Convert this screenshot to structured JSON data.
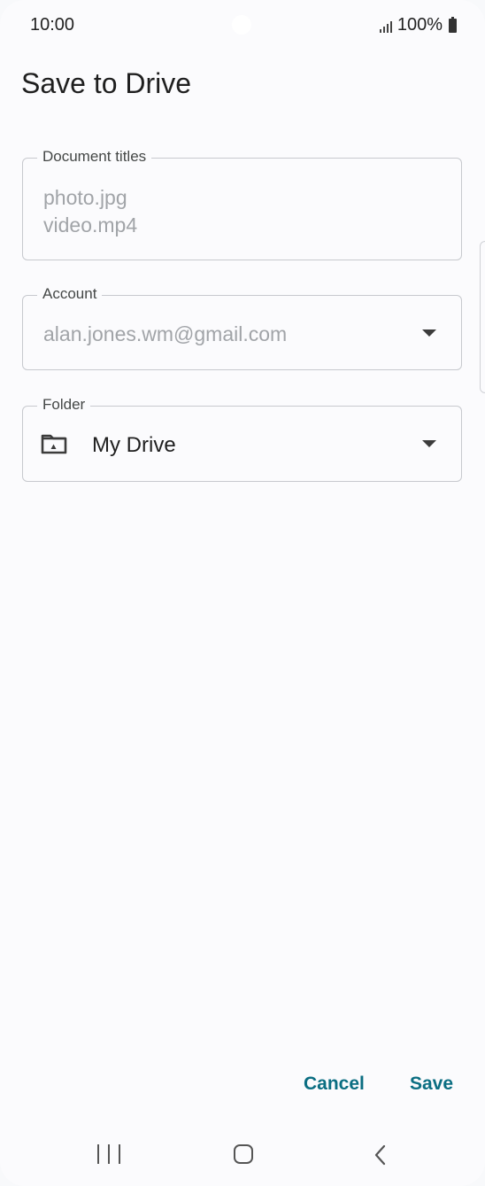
{
  "status_bar": {
    "time": "10:00",
    "battery": "100%"
  },
  "page": {
    "title": "Save to Drive"
  },
  "document_titles": {
    "label": "Document titles",
    "files": [
      "photo.jpg",
      "video.mp4"
    ]
  },
  "account": {
    "label": "Account",
    "value": "alan.jones.wm@gmail.com"
  },
  "folder": {
    "label": "Folder",
    "value": "My Drive",
    "icon": "drive-folder-icon"
  },
  "actions": {
    "cancel_label": "Cancel",
    "save_label": "Save"
  },
  "colors": {
    "accent": "#0b6e82",
    "outline": "#c7c9ce",
    "placeholder_text": "#a1a4a8"
  }
}
